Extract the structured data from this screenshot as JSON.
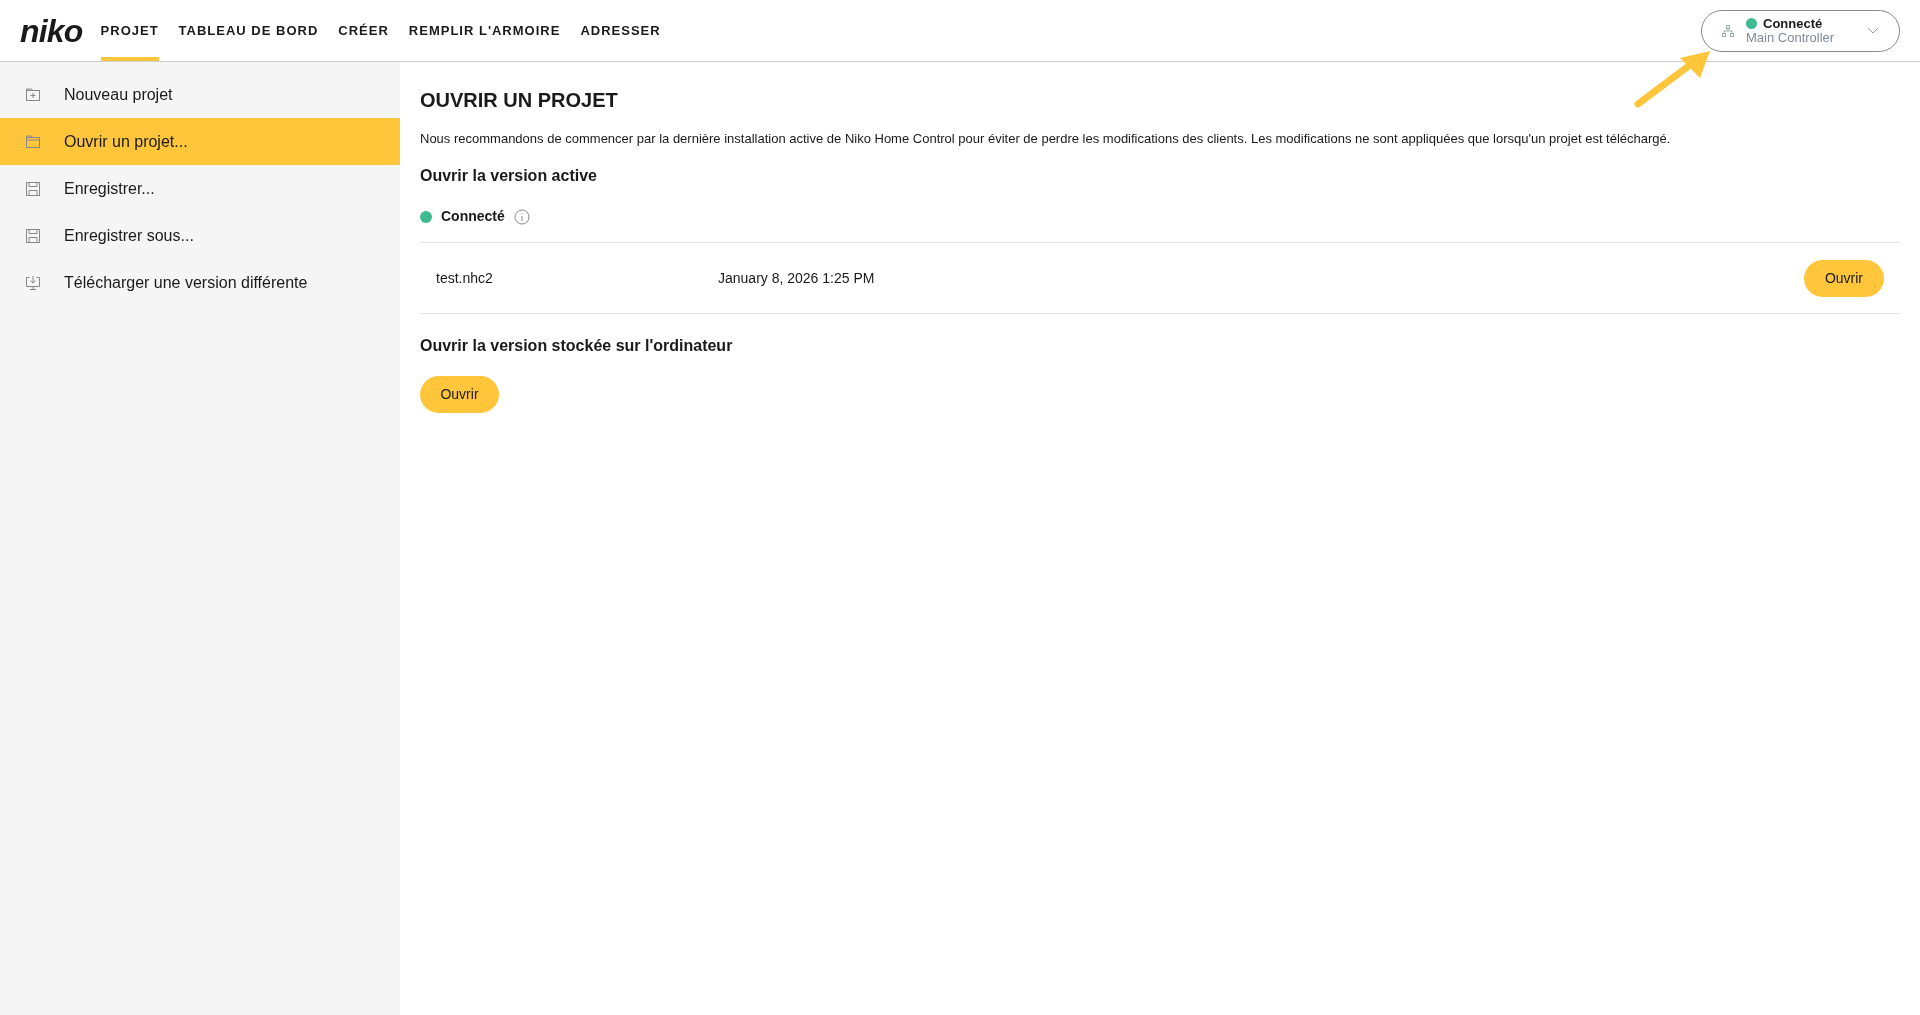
{
  "logo": "niko",
  "nav_tabs": [
    {
      "label": "PROJET",
      "selected": true
    },
    {
      "label": "TABLEAU DE BORD",
      "selected": false
    },
    {
      "label": "CRÉER",
      "selected": false
    },
    {
      "label": "REMPLIR L'ARMOIRE",
      "selected": false
    },
    {
      "label": "ADRESSER",
      "selected": false
    }
  ],
  "connection": {
    "status": "Connecté",
    "device": "Main Controller",
    "color": "#3dbd8f"
  },
  "sidebar": {
    "items": [
      {
        "label": "Nouveau projet",
        "kind": "new",
        "selected": false
      },
      {
        "label": "Ouvrir un projet...",
        "kind": "open",
        "selected": true
      },
      {
        "label": "Enregistrer...",
        "kind": "save",
        "selected": false
      },
      {
        "label": "Enregistrer sous...",
        "kind": "save",
        "selected": false
      },
      {
        "label": "Télécharger une version différente",
        "kind": "download",
        "selected": false
      }
    ]
  },
  "main": {
    "title": "OUVRIR UN PROJET",
    "intro": "Nous recommandons de commencer par la dernière installation active de Niko Home Control pour éviter de perdre les modifications des clients. Les modifications ne sont appliquées que lorsqu'un projet est téléchargé.",
    "active_section": {
      "heading": "Ouvrir la version active",
      "status": "Connecté",
      "color": "#3dbd8f",
      "file": {
        "name": "test.nhc2",
        "date": "January 8, 2026 1:25 PM",
        "button": "Ouvrir"
      }
    },
    "local_section": {
      "heading": "Ouvrir la version stockée sur l'ordinateur",
      "button": "Ouvrir"
    }
  }
}
